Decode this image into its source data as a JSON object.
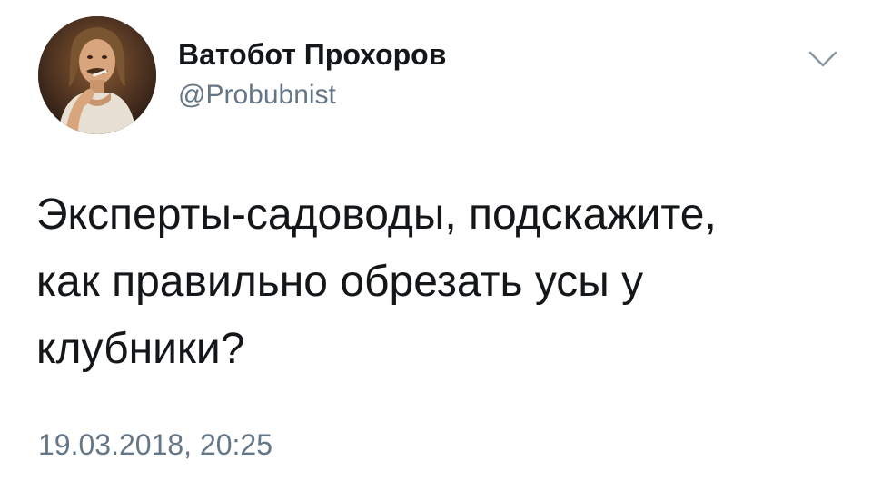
{
  "author": {
    "display_name": "Ватобот Прохоров",
    "handle": "@Probubnist",
    "avatar_icon": "user-avatar-photo"
  },
  "menu_icon": "chevron-down-icon",
  "tweet": {
    "text": "Эксперты-садоводы, подскажите,\nкак правильно обрезать усы у\nклубники?",
    "timestamp": "19.03.2018, 20:25"
  },
  "colors": {
    "text_primary": "#14171a",
    "text_secondary": "#657786",
    "chevron": "#8899a6",
    "background": "#ffffff"
  }
}
